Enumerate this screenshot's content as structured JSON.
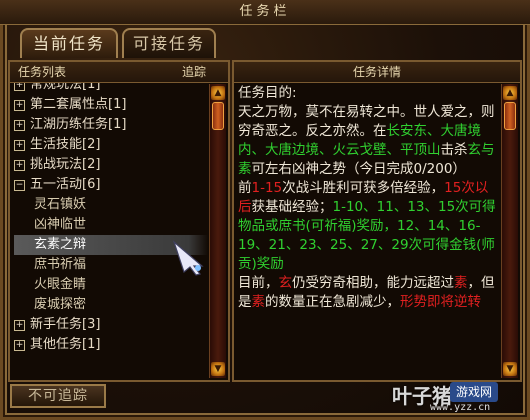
{
  "window": {
    "title": "任务栏"
  },
  "tabs": [
    {
      "label": "当前任务"
    },
    {
      "label": "可接任务"
    }
  ],
  "left_panel": {
    "header": "任务列表",
    "header_action": "追踪",
    "items": [
      {
        "label": "常规玩法[1]",
        "kind": "group",
        "expand": "+"
      },
      {
        "label": "第二套属性点[1]",
        "kind": "group",
        "expand": "+"
      },
      {
        "label": "江湖历练任务[1]",
        "kind": "group",
        "expand": "+"
      },
      {
        "label": "生活技能[2]",
        "kind": "group",
        "expand": "+"
      },
      {
        "label": "挑战玩法[2]",
        "kind": "group",
        "expand": "+"
      },
      {
        "label": "五一活动[6]",
        "kind": "group",
        "expand": "−"
      },
      {
        "label": "灵石镇妖",
        "kind": "child"
      },
      {
        "label": "凶神临世",
        "kind": "child"
      },
      {
        "label": "玄素之辩",
        "kind": "child",
        "selected": true
      },
      {
        "label": "庶书祈福",
        "kind": "child"
      },
      {
        "label": "火眼金睛",
        "kind": "child"
      },
      {
        "label": "废城探密",
        "kind": "child"
      },
      {
        "label": "新手任务[3]",
        "kind": "group",
        "expand": "+"
      },
      {
        "label": "其他任务[1]",
        "kind": "group",
        "expand": "+"
      }
    ]
  },
  "right_panel": {
    "header": "任务详情",
    "objective_heading": "任务目的:",
    "objective_text_1": "天之万物，莫不在易转之中。世人爱之，则穷奇恶之。反之亦然。在",
    "objective_places": "长安东、大唐境内、大唐边境、火云戈壁、平顶山",
    "objective_text_2": "击杀",
    "objective_target": "玄与素",
    "objective_text_3": "可左右凶神之势（今日完成0/200）",
    "reward_prefix": "前",
    "reward_range": "1-15",
    "reward_text_1": "次战斗胜利可获多倍经验，",
    "reward_after15": "15次以后",
    "reward_text_2": "获基础经验；",
    "reward_special": "1-10、11、13、15次可得物品或庶书(可祈福)奖励，12、14、16-19、21、23、25、27、29次可得金钱(师贡)奖励",
    "status_text_1": "目前，",
    "status_xuan": "玄",
    "status_text_2": "仍受穷奇相助，能力远超过",
    "status_su": "素",
    "status_text_3": "，但是",
    "status_su2": "素",
    "status_text_4": "的数量正在急剧减少，",
    "status_warning": "形势即将逆转"
  },
  "footer": {
    "untrack_label": "不可追踪"
  },
  "watermark": {
    "brand": "叶子猪",
    "badge": "游戏网",
    "url": "www.yzz.cn"
  },
  "colors": {
    "accent_green": "#30d030",
    "accent_red": "#e02020",
    "border_gold": "#a08050"
  }
}
